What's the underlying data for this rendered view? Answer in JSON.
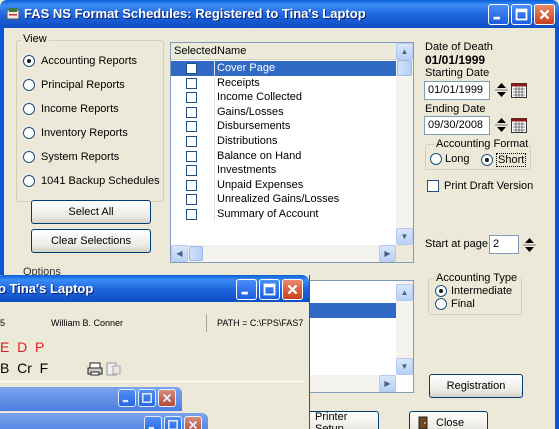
{
  "main_window": {
    "title": "FAS NS Format Schedules: Registered to Tina's Laptop"
  },
  "view": {
    "legend": "View",
    "options": [
      {
        "label": "Accounting Reports",
        "selected": true
      },
      {
        "label": "Principal Reports",
        "selected": false
      },
      {
        "label": "Income Reports",
        "selected": false
      },
      {
        "label": "Inventory Reports",
        "selected": false
      },
      {
        "label": "System Reports",
        "selected": false
      },
      {
        "label": "1041 Backup Schedules",
        "selected": false
      }
    ],
    "select_all": "Select All",
    "clear_selections": "Clear Selections",
    "options_legend": "Options"
  },
  "report_list": {
    "columns": [
      "Selected",
      "Name"
    ],
    "rows": [
      {
        "name": "Cover Page",
        "selected_row": true
      },
      {
        "name": "Receipts",
        "selected_row": false
      },
      {
        "name": "Income Collected",
        "selected_row": false
      },
      {
        "name": "Gains/Losses",
        "selected_row": false
      },
      {
        "name": "Disbursements",
        "selected_row": false
      },
      {
        "name": "Distributions",
        "selected_row": false
      },
      {
        "name": "Balance on Hand",
        "selected_row": false
      },
      {
        "name": "Investments",
        "selected_row": false
      },
      {
        "name": "Unpaid Expenses",
        "selected_row": false
      },
      {
        "name": "Unrealized Gains/Losses",
        "selected_row": false
      },
      {
        "name": "Summary of Account",
        "selected_row": false
      }
    ]
  },
  "dates": {
    "date_of_death_label": "Date of Death",
    "date_of_death_value": "01/01/1999",
    "starting_label": "Starting Date",
    "starting_value": "01/01/1999",
    "ending_label": "Ending Date",
    "ending_value": "09/30/2008"
  },
  "accounting_format": {
    "legend": "Accounting Format",
    "long": "Long",
    "short": "Short",
    "selected": "Short"
  },
  "print_draft": "Print Draft Version",
  "start_at_page": {
    "label": "Start at page:",
    "value": "2"
  },
  "accounting_type": {
    "legend": "Accounting Type",
    "intermediate": "Intermediate",
    "final": "Final",
    "selected": "Intermediate"
  },
  "buttons": {
    "registration": "Registration",
    "printer_setup": "Printer Setup",
    "close": "Close"
  },
  "overlay_window": {
    "title": "o Tina's Laptop",
    "field_left": "5",
    "client": "William B. Conner",
    "path": "PATH = C:\\FPS\\FAS7",
    "red_letters": "E  D  P",
    "toolbar_letters": "B  Cr  F"
  }
}
